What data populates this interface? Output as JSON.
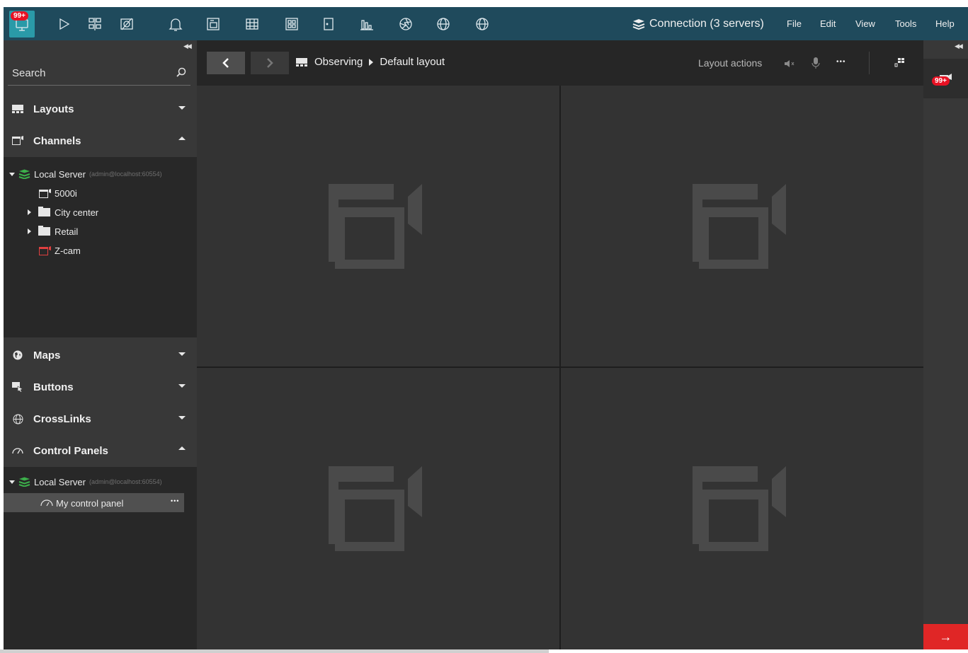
{
  "topbar": {
    "monitor_badge": "99+",
    "connection_label": "Connection (3 servers)",
    "menu": [
      "File",
      "Edit",
      "View",
      "Tools",
      "Help"
    ],
    "icons": [
      "monitor-icon",
      "play-icon",
      "grid-layout-icon",
      "no-camera-icon",
      "bell-icon",
      "copy-icon",
      "table-icon",
      "video-wall-icon",
      "door-icon",
      "bar-chart-icon",
      "aperture-icon",
      "www-icon",
      "www-icon-2"
    ],
    "accent_color": "#1f4a5c",
    "badge_color": "#e81123"
  },
  "sidebar": {
    "search_placeholder": "Search",
    "sections": {
      "layouts": "Layouts",
      "channels": "Channels",
      "maps": "Maps",
      "buttons": "Buttons",
      "crosslinks": "CrossLinks",
      "control_panels": "Control Panels"
    },
    "channels_tree": {
      "server_name": "Local Server",
      "server_login": "(admin@localhost:60554)",
      "items": [
        {
          "label": "5000i",
          "type": "camera"
        },
        {
          "label": "City center",
          "type": "folder"
        },
        {
          "label": "Retail",
          "type": "folder"
        },
        {
          "label": "Z-cam",
          "type": "camera-offline"
        }
      ]
    },
    "control_tree": {
      "server_name": "Local Server",
      "server_login": "(admin@localhost:60554)",
      "panel": "My control panel",
      "panel_menu": "•••"
    }
  },
  "main": {
    "breadcrumb": {
      "mode": "Observing",
      "layout": "Default layout"
    },
    "layout_actions": "Layout actions",
    "more": "•••"
  },
  "rightpanel": {
    "badge": "99+",
    "arrow": "→"
  }
}
